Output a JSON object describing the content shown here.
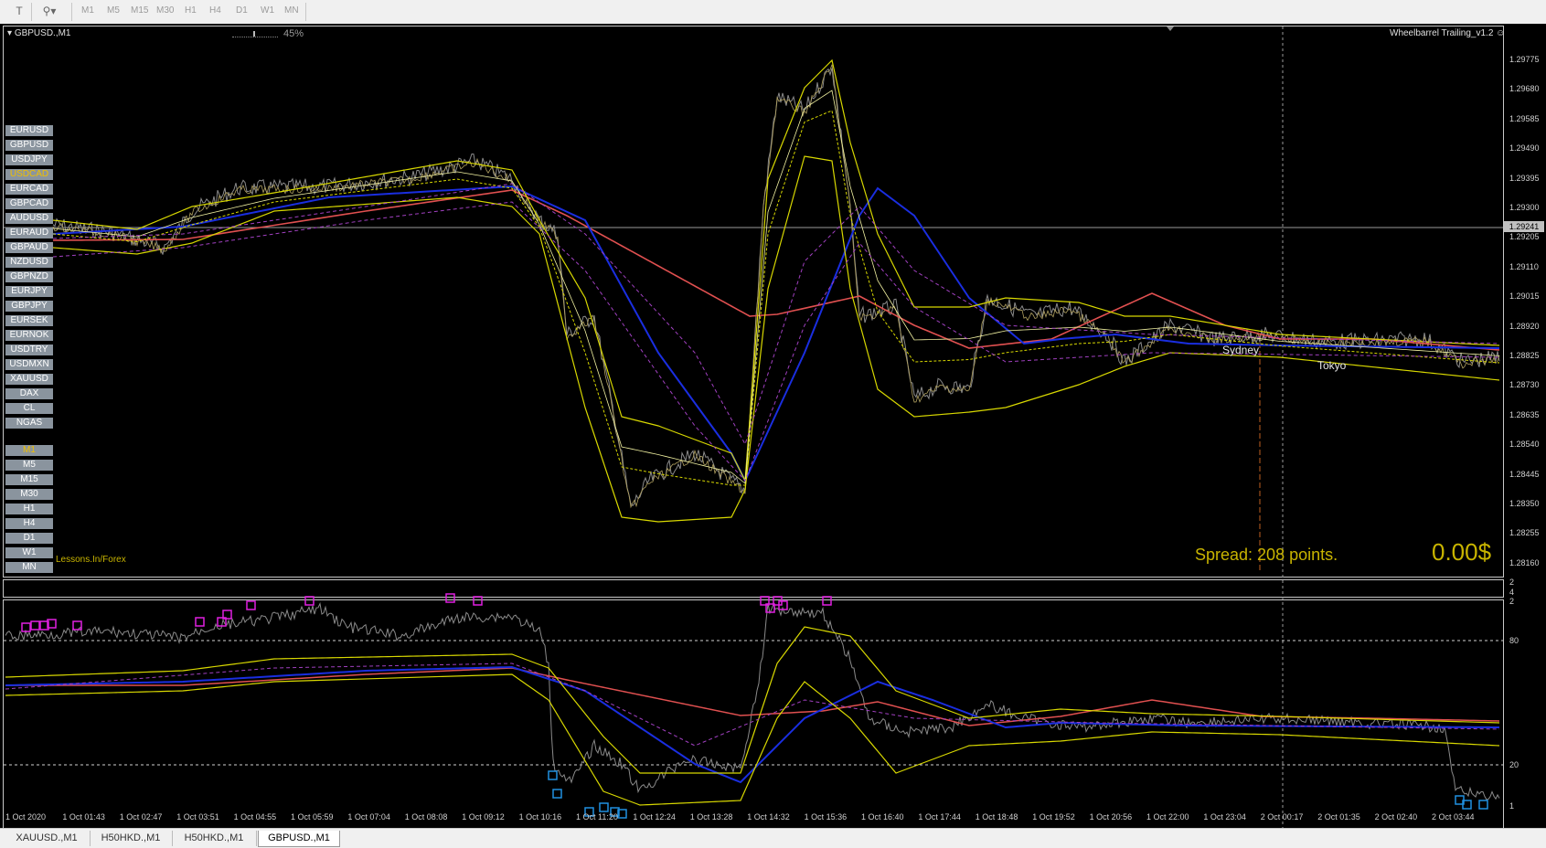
{
  "toolbar": {
    "timeframes": [
      "M1",
      "M5",
      "M15",
      "M30",
      "H1",
      "H4",
      "D1",
      "W1",
      "MN"
    ]
  },
  "chart": {
    "symbol_label": "GBPUSD.,M1",
    "progress_text": "45%",
    "progress_value": 0.45,
    "ea_label": "Wheelbarrel Trailing_v1.2",
    "watermark": "Lessons.In/Forex",
    "spread_text": "Spread: 208 points.",
    "profit_text": "0.00$",
    "session_sydney": "Sydney",
    "session_tokyo": "Tokyo",
    "current_price": "1.29241",
    "colors": {
      "ma_red": "#e05050",
      "ma_blue": "#1a2ee0",
      "band_yellow": "#d8d800",
      "band_purple": "#a040c0",
      "price_gray": "#8a8a8a",
      "spread_text": "#c8b400",
      "rsi_high_marker": "#e020e0",
      "rsi_low_marker": "#2090e0"
    }
  },
  "symbols": [
    "EURUSD",
    "GBPUSD",
    "USDJPY",
    "USDCAD",
    "EURCAD",
    "GBPCAD",
    "AUDUSD",
    "EURAUD",
    "GBPAUD",
    "NZDUSD",
    "GBPNZD",
    "EURJPY",
    "GBPJPY",
    "EURSEK",
    "EURNOK",
    "USDTRY",
    "USDMXN",
    "XAUUSD",
    "DAX",
    "CL",
    "NGAS"
  ],
  "active_symbol": "USDCAD",
  "side_timeframes": [
    "M1",
    "M5",
    "M15",
    "M30",
    "H1",
    "H4",
    "D1",
    "W1",
    "MN"
  ],
  "active_timeframe": "M1",
  "price_axis": [
    "1.29775",
    "1.29680",
    "1.29585",
    "1.29490",
    "1.29395",
    "1.29300",
    "1.29205",
    "1.29110",
    "1.29015",
    "1.28920",
    "1.28825",
    "1.28730",
    "1.28635",
    "1.28540",
    "1.28445",
    "1.28350",
    "1.28255",
    "1.28160"
  ],
  "sub_axis": [
    "2",
    "80",
    "20",
    "1"
  ],
  "sub_top_labels": [
    "2",
    "4"
  ],
  "time_axis": [
    "1 Oct 2020",
    "1 Oct 01:43",
    "1 Oct 02:47",
    "1 Oct 03:51",
    "1 Oct 04:55",
    "1 Oct 05:59",
    "1 Oct 07:04",
    "1 Oct 08:08",
    "1 Oct 09:12",
    "1 Oct 10:16",
    "1 Oct 11:20",
    "1 Oct 12:24",
    "1 Oct 13:28",
    "1 Oct 14:32",
    "1 Oct 15:36",
    "1 Oct 16:40",
    "1 Oct 17:44",
    "1 Oct 18:48",
    "1 Oct 19:52",
    "1 Oct 20:56",
    "1 Oct 22:00",
    "1 Oct 23:04",
    "2 Oct 00:17",
    "2 Oct 01:35",
    "2 Oct 02:40",
    "2 Oct 03:44"
  ],
  "tabs": [
    "XAUUSD.,M1",
    "H50HKD.,M1",
    "H50HKD.,M1",
    "GBPUSD.,M1"
  ],
  "active_tab": 3
}
